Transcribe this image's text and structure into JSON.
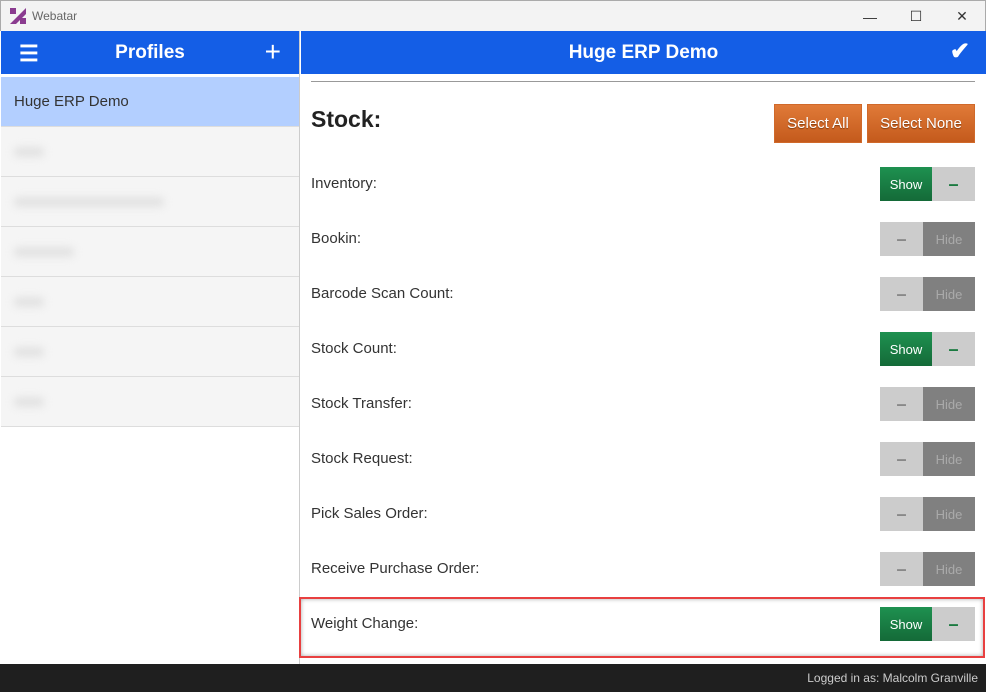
{
  "window": {
    "title": "Webatar",
    "minimize": "—",
    "maximize": "☐",
    "close": "✕"
  },
  "sidebar": {
    "title": "Profiles",
    "menu_icon": "☰",
    "add_icon": "+",
    "items": [
      {
        "label": "Huge ERP Demo",
        "active": true
      }
    ],
    "blurred_count": 6
  },
  "main": {
    "title": "Huge ERP Demo",
    "confirm_icon": "✔",
    "section": "Stock:",
    "select_all": "Select All",
    "select_none": "Select None",
    "rows": [
      {
        "label": "Inventory:",
        "state": "show"
      },
      {
        "label": "Bookin:",
        "state": "hide"
      },
      {
        "label": "Barcode Scan Count:",
        "state": "hide"
      },
      {
        "label": "Stock Count:",
        "state": "show"
      },
      {
        "label": "Stock Transfer:",
        "state": "hide"
      },
      {
        "label": "Stock Request:",
        "state": "hide"
      },
      {
        "label": "Pick Sales Order:",
        "state": "hide"
      },
      {
        "label": "Receive Purchase Order:",
        "state": "hide"
      },
      {
        "label": "Weight Change:",
        "state": "show"
      }
    ],
    "show_label": "Show",
    "hide_label": "Hide",
    "dash": "–"
  },
  "footer": {
    "status": "Logged in as: Malcolm Granville"
  }
}
